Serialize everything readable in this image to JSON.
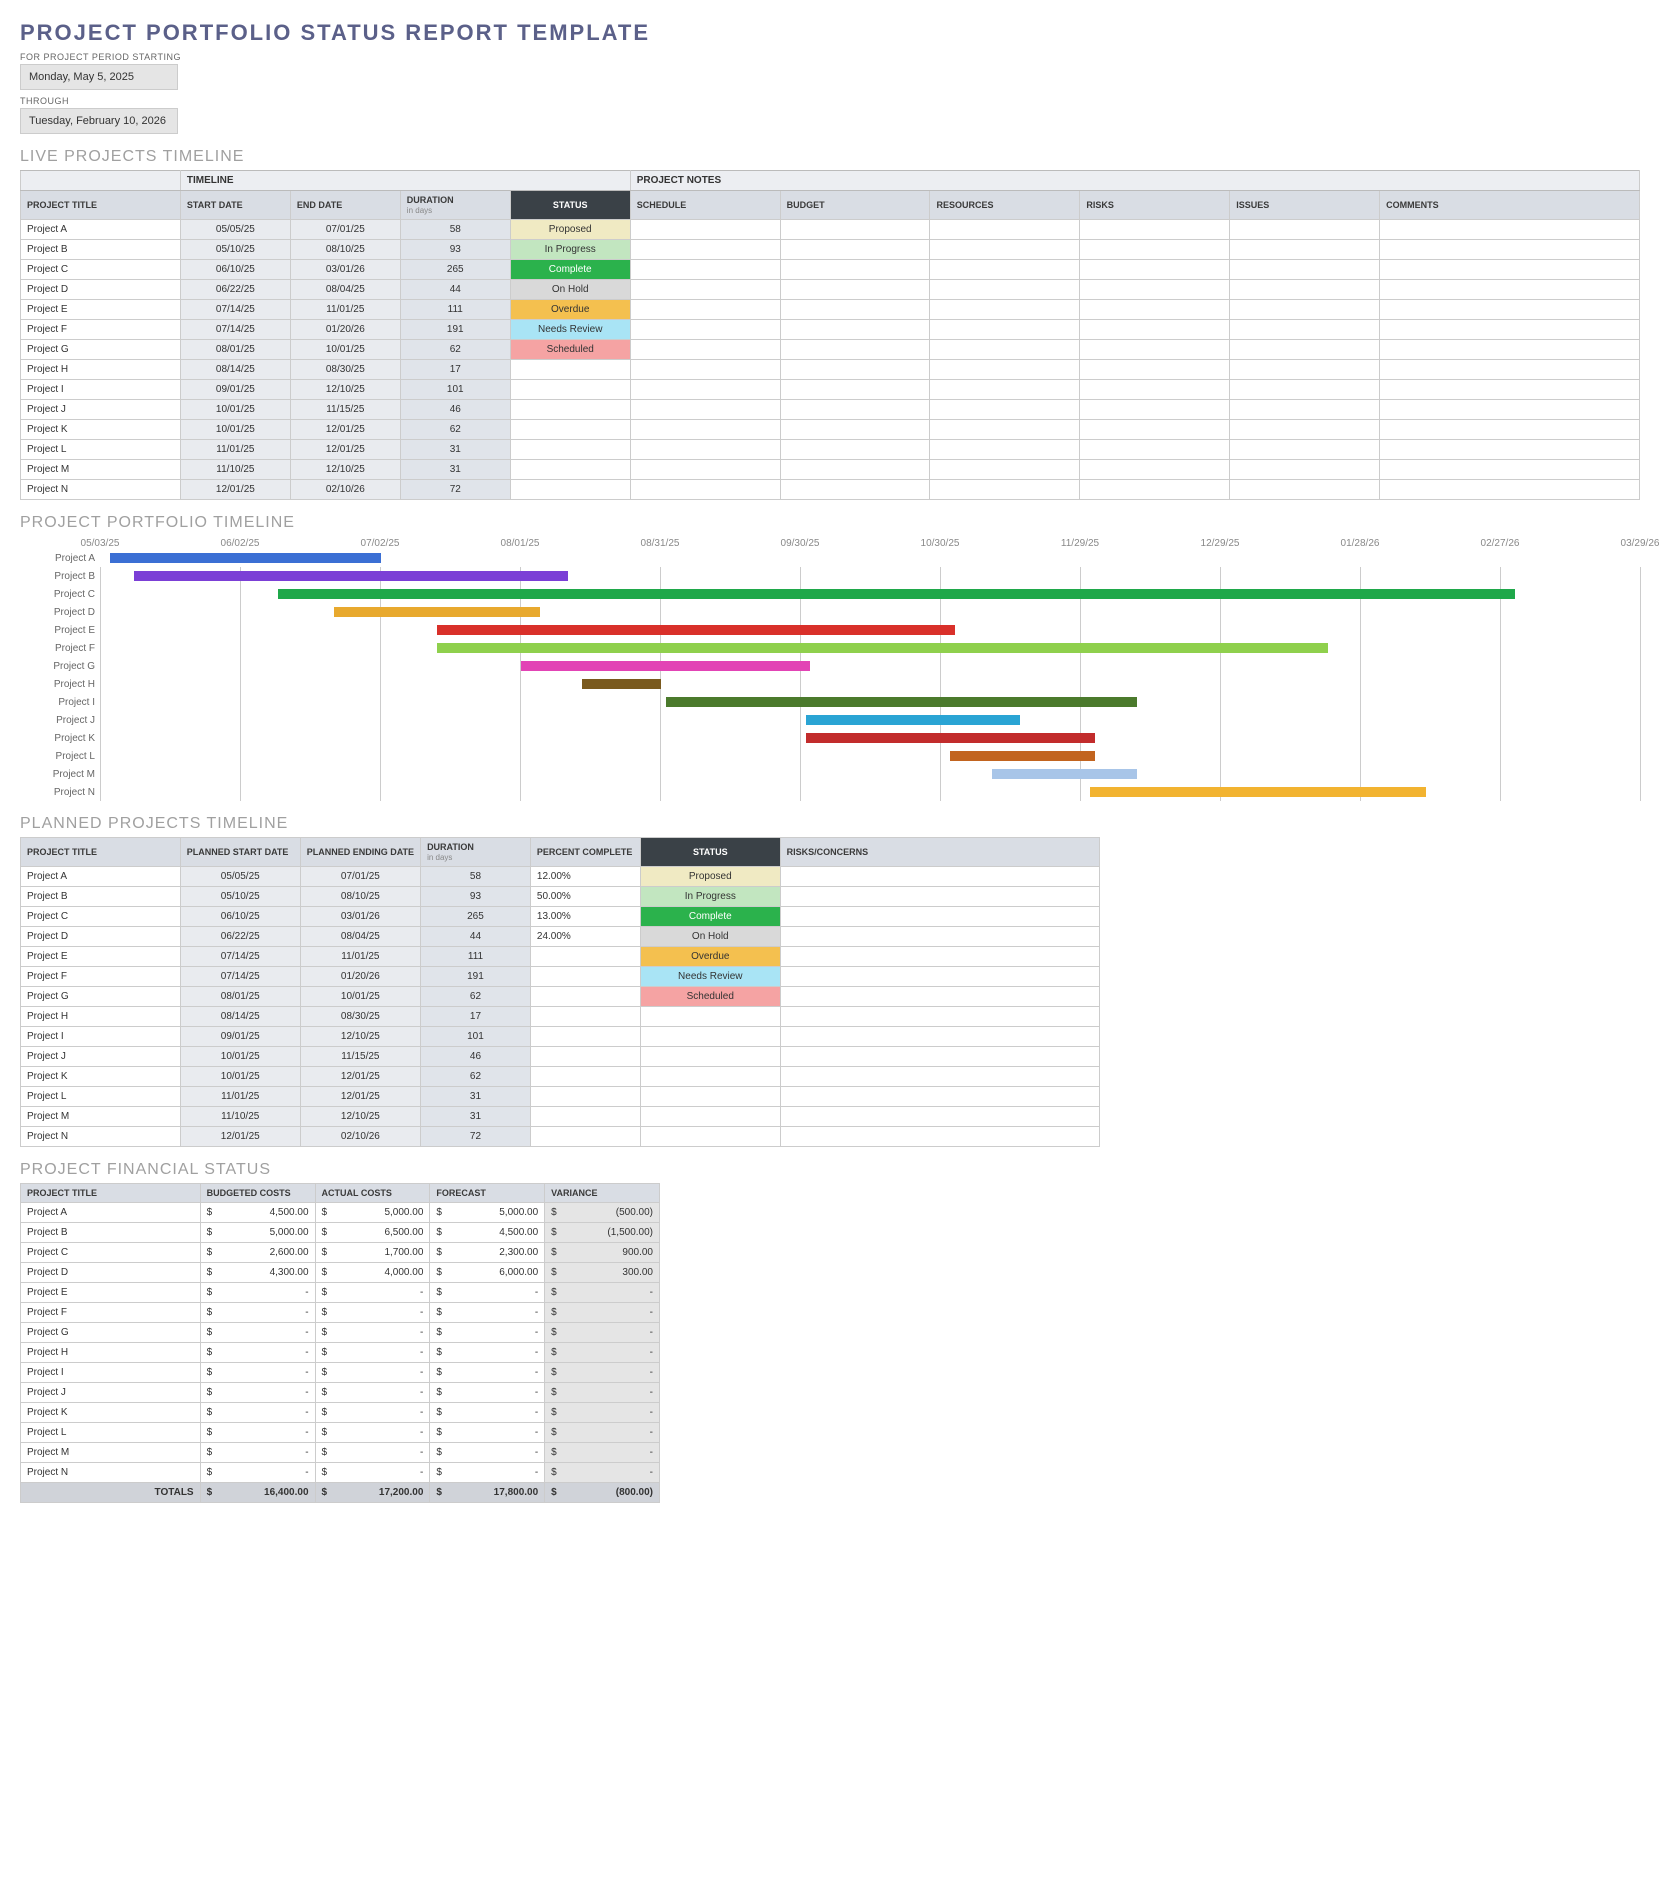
{
  "header": {
    "title": "PROJECT PORTFOLIO STATUS REPORT TEMPLATE",
    "period_start_label": "FOR PROJECT PERIOD STARTING",
    "period_start": "Monday, May 5, 2025",
    "through_label": "THROUGH",
    "period_end": "Tuesday, February 10, 2026"
  },
  "sections": {
    "live": "LIVE PROJECTS TIMELINE",
    "portfolio": "PROJECT PORTFOLIO TIMELINE",
    "planned": "PLANNED PROJECTS TIMELINE",
    "financial": "PROJECT FINANCIAL STATUS"
  },
  "live_table": {
    "group_timeline": "TIMELINE",
    "group_notes": "PROJECT NOTES",
    "cols": {
      "title": "PROJECT TITLE",
      "start": "START DATE",
      "end": "END DATE",
      "duration": "DURATION",
      "duration_sub": "in days",
      "status": "STATUS",
      "schedule": "SCHEDULE",
      "budget": "BUDGET",
      "resources": "RESOURCES",
      "risks": "RISKS",
      "issues": "ISSUES",
      "comments": "COMMENTS"
    },
    "rows": [
      {
        "title": "Project A",
        "start": "05/05/25",
        "end": "07/01/25",
        "dur": "58",
        "status": "Proposed",
        "sclass": "s-proposed"
      },
      {
        "title": "Project B",
        "start": "05/10/25",
        "end": "08/10/25",
        "dur": "93",
        "status": "In Progress",
        "sclass": "s-inprogress"
      },
      {
        "title": "Project C",
        "start": "06/10/25",
        "end": "03/01/26",
        "dur": "265",
        "status": "Complete",
        "sclass": "s-complete"
      },
      {
        "title": "Project D",
        "start": "06/22/25",
        "end": "08/04/25",
        "dur": "44",
        "status": "On Hold",
        "sclass": "s-onhold"
      },
      {
        "title": "Project E",
        "start": "07/14/25",
        "end": "11/01/25",
        "dur": "111",
        "status": "Overdue",
        "sclass": "s-overdue"
      },
      {
        "title": "Project F",
        "start": "07/14/25",
        "end": "01/20/26",
        "dur": "191",
        "status": "Needs Review",
        "sclass": "s-needs"
      },
      {
        "title": "Project G",
        "start": "08/01/25",
        "end": "10/01/25",
        "dur": "62",
        "status": "Scheduled",
        "sclass": "s-scheduled"
      },
      {
        "title": "Project H",
        "start": "08/14/25",
        "end": "08/30/25",
        "dur": "17",
        "status": "",
        "sclass": ""
      },
      {
        "title": "Project I",
        "start": "09/01/25",
        "end": "12/10/25",
        "dur": "101",
        "status": "",
        "sclass": ""
      },
      {
        "title": "Project J",
        "start": "10/01/25",
        "end": "11/15/25",
        "dur": "46",
        "status": "",
        "sclass": ""
      },
      {
        "title": "Project K",
        "start": "10/01/25",
        "end": "12/01/25",
        "dur": "62",
        "status": "",
        "sclass": ""
      },
      {
        "title": "Project L",
        "start": "11/01/25",
        "end": "12/01/25",
        "dur": "31",
        "status": "",
        "sclass": ""
      },
      {
        "title": "Project M",
        "start": "11/10/25",
        "end": "12/10/25",
        "dur": "31",
        "status": "",
        "sclass": ""
      },
      {
        "title": "Project N",
        "start": "12/01/25",
        "end": "02/10/26",
        "dur": "72",
        "status": "",
        "sclass": ""
      }
    ]
  },
  "gantt": {
    "dates": [
      "05/03/25",
      "06/02/25",
      "07/02/25",
      "08/01/25",
      "08/31/25",
      "09/30/25",
      "10/30/25",
      "11/29/25",
      "12/29/25",
      "01/28/26",
      "02/27/26",
      "03/29/26"
    ],
    "origin": "2025-05-03",
    "span": 330,
    "rows": [
      {
        "label": "Project A",
        "start": 2,
        "dur": 58,
        "color": "#3b6fd4"
      },
      {
        "label": "Project B",
        "start": 7,
        "dur": 93,
        "color": "#7b3fd6"
      },
      {
        "label": "Project C",
        "start": 38,
        "dur": 265,
        "color": "#1fa84a"
      },
      {
        "label": "Project D",
        "start": 50,
        "dur": 44,
        "color": "#e8a92e"
      },
      {
        "label": "Project E",
        "start": 72,
        "dur": 111,
        "color": "#d9302a"
      },
      {
        "label": "Project F",
        "start": 72,
        "dur": 191,
        "color": "#8fd04d"
      },
      {
        "label": "Project G",
        "start": 90,
        "dur": 62,
        "color": "#e244b5"
      },
      {
        "label": "Project H",
        "start": 103,
        "dur": 17,
        "color": "#7a5a1e"
      },
      {
        "label": "Project I",
        "start": 121,
        "dur": 101,
        "color": "#4b7a2c"
      },
      {
        "label": "Project J",
        "start": 151,
        "dur": 46,
        "color": "#2aa4d4"
      },
      {
        "label": "Project K",
        "start": 151,
        "dur": 62,
        "color": "#c22c2c"
      },
      {
        "label": "Project L",
        "start": 182,
        "dur": 31,
        "color": "#c2641f"
      },
      {
        "label": "Project M",
        "start": 191,
        "dur": 31,
        "color": "#a8c5e8"
      },
      {
        "label": "Project N",
        "start": 212,
        "dur": 72,
        "color": "#f2b330"
      }
    ]
  },
  "planned_table": {
    "cols": {
      "title": "PROJECT TITLE",
      "pstart": "PLANNED START DATE",
      "pend": "PLANNED ENDING DATE",
      "duration": "DURATION",
      "duration_sub": "in days",
      "pct": "PERCENT COMPLETE",
      "status": "STATUS",
      "risks": "RISKS/CONCERNS"
    },
    "rows": [
      {
        "title": "Project A",
        "start": "05/05/25",
        "end": "07/01/25",
        "dur": "58",
        "pct": "12.00%",
        "status": "Proposed",
        "sclass": "s-proposed"
      },
      {
        "title": "Project B",
        "start": "05/10/25",
        "end": "08/10/25",
        "dur": "93",
        "pct": "50.00%",
        "status": "In Progress",
        "sclass": "s-inprogress"
      },
      {
        "title": "Project C",
        "start": "06/10/25",
        "end": "03/01/26",
        "dur": "265",
        "pct": "13.00%",
        "status": "Complete",
        "sclass": "s-complete"
      },
      {
        "title": "Project D",
        "start": "06/22/25",
        "end": "08/04/25",
        "dur": "44",
        "pct": "24.00%",
        "status": "On Hold",
        "sclass": "s-onhold"
      },
      {
        "title": "Project E",
        "start": "07/14/25",
        "end": "11/01/25",
        "dur": "111",
        "pct": "",
        "status": "Overdue",
        "sclass": "s-overdue"
      },
      {
        "title": "Project F",
        "start": "07/14/25",
        "end": "01/20/26",
        "dur": "191",
        "pct": "",
        "status": "Needs Review",
        "sclass": "s-needs"
      },
      {
        "title": "Project G",
        "start": "08/01/25",
        "end": "10/01/25",
        "dur": "62",
        "pct": "",
        "status": "Scheduled",
        "sclass": "s-scheduled"
      },
      {
        "title": "Project H",
        "start": "08/14/25",
        "end": "08/30/25",
        "dur": "17",
        "pct": "",
        "status": "",
        "sclass": ""
      },
      {
        "title": "Project I",
        "start": "09/01/25",
        "end": "12/10/25",
        "dur": "101",
        "pct": "",
        "status": "",
        "sclass": ""
      },
      {
        "title": "Project J",
        "start": "10/01/25",
        "end": "11/15/25",
        "dur": "46",
        "pct": "",
        "status": "",
        "sclass": ""
      },
      {
        "title": "Project K",
        "start": "10/01/25",
        "end": "12/01/25",
        "dur": "62",
        "pct": "",
        "status": "",
        "sclass": ""
      },
      {
        "title": "Project L",
        "start": "11/01/25",
        "end": "12/01/25",
        "dur": "31",
        "pct": "",
        "status": "",
        "sclass": ""
      },
      {
        "title": "Project M",
        "start": "11/10/25",
        "end": "12/10/25",
        "dur": "31",
        "pct": "",
        "status": "",
        "sclass": ""
      },
      {
        "title": "Project N",
        "start": "12/01/25",
        "end": "02/10/26",
        "dur": "72",
        "pct": "",
        "status": "",
        "sclass": ""
      }
    ]
  },
  "financial_table": {
    "cols": {
      "title": "PROJECT TITLE",
      "budget": "BUDGETED COSTS",
      "actual": "ACTUAL COSTS",
      "forecast": "FORECAST",
      "variance": "VARIANCE"
    },
    "currency": "$",
    "rows": [
      {
        "title": "Project A",
        "b": "4,500.00",
        "a": "5,000.00",
        "f": "5,000.00",
        "v": "(500.00)"
      },
      {
        "title": "Project B",
        "b": "5,000.00",
        "a": "6,500.00",
        "f": "4,500.00",
        "v": "(1,500.00)"
      },
      {
        "title": "Project C",
        "b": "2,600.00",
        "a": "1,700.00",
        "f": "2,300.00",
        "v": "900.00"
      },
      {
        "title": "Project D",
        "b": "4,300.00",
        "a": "4,000.00",
        "f": "6,000.00",
        "v": "300.00"
      },
      {
        "title": "Project E",
        "b": "-",
        "a": "-",
        "f": "-",
        "v": "-"
      },
      {
        "title": "Project F",
        "b": "-",
        "a": "-",
        "f": "-",
        "v": "-"
      },
      {
        "title": "Project G",
        "b": "-",
        "a": "-",
        "f": "-",
        "v": "-"
      },
      {
        "title": "Project H",
        "b": "-",
        "a": "-",
        "f": "-",
        "v": "-"
      },
      {
        "title": "Project I",
        "b": "-",
        "a": "-",
        "f": "-",
        "v": "-"
      },
      {
        "title": "Project J",
        "b": "-",
        "a": "-",
        "f": "-",
        "v": "-"
      },
      {
        "title": "Project K",
        "b": "-",
        "a": "-",
        "f": "-",
        "v": "-"
      },
      {
        "title": "Project L",
        "b": "-",
        "a": "-",
        "f": "-",
        "v": "-"
      },
      {
        "title": "Project M",
        "b": "-",
        "a": "-",
        "f": "-",
        "v": "-"
      },
      {
        "title": "Project N",
        "b": "-",
        "a": "-",
        "f": "-",
        "v": "-"
      }
    ],
    "totals": {
      "label": "TOTALS",
      "b": "16,400.00",
      "a": "17,200.00",
      "f": "17,800.00",
      "v": "(800.00)"
    }
  },
  "chart_data": {
    "type": "gantt",
    "title": "PROJECT PORTFOLIO TIMELINE",
    "x_ticks": [
      "05/03/25",
      "06/02/25",
      "07/02/25",
      "08/01/25",
      "08/31/25",
      "09/30/25",
      "10/30/25",
      "11/29/25",
      "12/29/25",
      "01/28/26",
      "02/27/26",
      "03/29/26"
    ],
    "series": [
      {
        "name": "Project A",
        "start": "05/05/25",
        "end": "07/01/25",
        "color": "#3b6fd4"
      },
      {
        "name": "Project B",
        "start": "05/10/25",
        "end": "08/10/25",
        "color": "#7b3fd6"
      },
      {
        "name": "Project C",
        "start": "06/10/25",
        "end": "03/01/26",
        "color": "#1fa84a"
      },
      {
        "name": "Project D",
        "start": "06/22/25",
        "end": "08/04/25",
        "color": "#e8a92e"
      },
      {
        "name": "Project E",
        "start": "07/14/25",
        "end": "11/01/25",
        "color": "#d9302a"
      },
      {
        "name": "Project F",
        "start": "07/14/25",
        "end": "01/20/26",
        "color": "#8fd04d"
      },
      {
        "name": "Project G",
        "start": "08/01/25",
        "end": "10/01/25",
        "color": "#e244b5"
      },
      {
        "name": "Project H",
        "start": "08/14/25",
        "end": "08/30/25",
        "color": "#7a5a1e"
      },
      {
        "name": "Project I",
        "start": "09/01/25",
        "end": "12/10/25",
        "color": "#4b7a2c"
      },
      {
        "name": "Project J",
        "start": "10/01/25",
        "end": "11/15/25",
        "color": "#2aa4d4"
      },
      {
        "name": "Project K",
        "start": "10/01/25",
        "end": "12/01/25",
        "color": "#c22c2c"
      },
      {
        "name": "Project L",
        "start": "11/01/25",
        "end": "12/01/25",
        "color": "#c2641f"
      },
      {
        "name": "Project M",
        "start": "11/10/25",
        "end": "12/10/25",
        "color": "#a8c5e8"
      },
      {
        "name": "Project N",
        "start": "12/01/25",
        "end": "02/10/26",
        "color": "#f2b330"
      }
    ]
  }
}
